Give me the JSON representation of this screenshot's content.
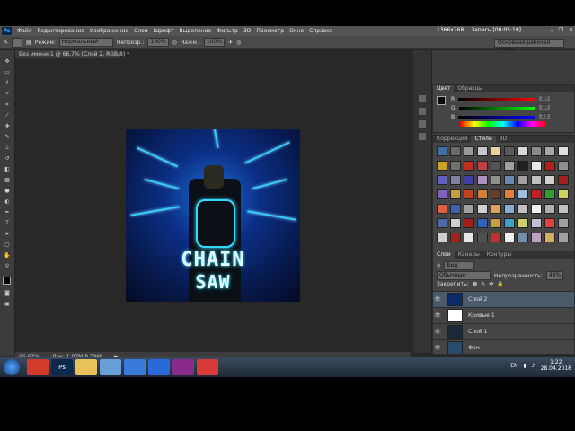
{
  "app": {
    "logo": "Ps"
  },
  "menu": [
    "Файл",
    "Редактирование",
    "Изображение",
    "Слои",
    "Шрифт",
    "Выделение",
    "Фильтр",
    "3D",
    "Просмотр",
    "Окно",
    "Справка"
  ],
  "recording": {
    "resolution": "1366x768",
    "status": "Запись [00:05:19]"
  },
  "options": {
    "mode_label": "Режим:",
    "mode_value": "Нормальный",
    "opacity_label": "Непрозр.:",
    "opacity_value": "100%",
    "pressure_label": "Нажм.:",
    "pressure_value": "100%",
    "workspace": "Основная рабочая среда"
  },
  "document": {
    "tab": "Без имени-1 @ 66,7% (Слой 2, RGB/8) *",
    "zoom": "66,67%",
    "doc_info": "Док: 1,07M/8,59M"
  },
  "artwork": {
    "title_line1": "CHAIN",
    "title_line2": "SAW"
  },
  "color_panel": {
    "tabs": [
      "Цвет",
      "Образцы"
    ],
    "rows": [
      {
        "label": "R",
        "value": "10",
        "color": "#ff3030"
      },
      {
        "label": "G",
        "value": "10",
        "color": "#30d030"
      },
      {
        "label": "B",
        "value": "13",
        "color": "#3060ff"
      }
    ]
  },
  "styles_panel": {
    "tabs": [
      "Коррекция",
      "Стили",
      "3D"
    ],
    "swatches": [
      "#3a6fa8",
      "#6a6a6a",
      "#9a9a9a",
      "#c8c8c8",
      "#e8d0a0",
      "#5a5a5a",
      "#d8d8d8",
      "#8a8a8a",
      "#a8a8a8",
      "#e0e0e0",
      "#d0a020",
      "#707070",
      "#c03020",
      "#c04040",
      "#555555",
      "#a0a0a0",
      "#202020",
      "#e8e8e8",
      "#b02020",
      "#909090",
      "#6060c0",
      "#8080a0",
      "#4040a0",
      "#b090c0",
      "#909090",
      "#6a8ab0",
      "#a0a0a0",
      "#c0c0c0",
      "#d0d0d0",
      "#a02020",
      "#8060c0",
      "#c0a040",
      "#c04020",
      "#d08030",
      "#6a3a2a",
      "#e08040",
      "#a0c0e0",
      "#c02020",
      "#30a030",
      "#d0d060",
      "#e06040",
      "#4060b0",
      "#a0a0a0",
      "#d0d0d0",
      "#e0a060",
      "#8aaad0",
      "#c0c0c0",
      "#f0f0f0",
      "#b0b0b0",
      "#c0c0c0",
      "#4a6ab0",
      "#d0d0d0",
      "#a02020",
      "#3060c0",
      "#c0a040",
      "#40a0c0",
      "#d0d060",
      "#c0c0d0",
      "#e04040",
      "#a0a0a0",
      "#d0d0d0",
      "#a02020",
      "#e8e8e8",
      "#505050",
      "#c03030",
      "#f0f0f0",
      "#7090b0",
      "#c0a0c0",
      "#d0b060",
      "#a0a0a0"
    ]
  },
  "layers_panel": {
    "tabs": [
      "Слои",
      "Каналы",
      "Контуры"
    ],
    "filter": "Вид",
    "blend_mode": "Обычные",
    "opacity_label": "Непрозрачность:",
    "opacity_value": "48%",
    "lock_label": "Закрепить:",
    "layers": [
      {
        "name": "Слой 2",
        "thumb": "#0b2a6a",
        "selected": true
      },
      {
        "name": "Кривые 1",
        "thumb": "#ffffff",
        "selected": false
      },
      {
        "name": "Слой 1",
        "thumb": "#1a2a3a",
        "selected": false
      },
      {
        "name": "Фон",
        "thumb": "#2a4a6a",
        "selected": false
      }
    ]
  },
  "taskbar": {
    "apps": [
      {
        "name": "chrome",
        "color": "#d23b2a",
        "label": ""
      },
      {
        "name": "photoshop",
        "color": "#0b2a4a",
        "label": "Ps"
      },
      {
        "name": "explorer",
        "color": "#e8c15a",
        "label": ""
      },
      {
        "name": "movie-maker",
        "color": "#6aa0d8",
        "label": ""
      },
      {
        "name": "audio",
        "color": "#3a7ad8",
        "label": ""
      },
      {
        "name": "maxthon",
        "color": "#2a6ad8",
        "label": ""
      },
      {
        "name": "winrar",
        "color": "#8a2a8a",
        "label": ""
      },
      {
        "name": "recorder",
        "color": "#d83a3a",
        "label": ""
      }
    ],
    "language": "EN",
    "time": "1:22",
    "date": "28.04.2018"
  }
}
